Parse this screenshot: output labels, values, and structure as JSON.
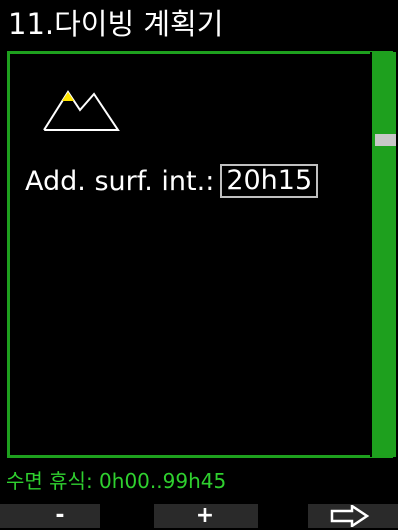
{
  "header": {
    "title": "11.다이빙 계획기"
  },
  "form": {
    "field_label": "Add. surf. int.:",
    "field_value": "20h15"
  },
  "footer": {
    "range_text": "수면 휴식: 0h00..99h45"
  },
  "softkeys": {
    "left_label": "-",
    "middle_label": "+",
    "right_icon": "arrow-right-icon"
  },
  "colors": {
    "accent": "#1ea01e",
    "range_text": "#2fd02f",
    "mountain_peak": "#ffe600",
    "softkey_bg": "#2a2a2a"
  }
}
